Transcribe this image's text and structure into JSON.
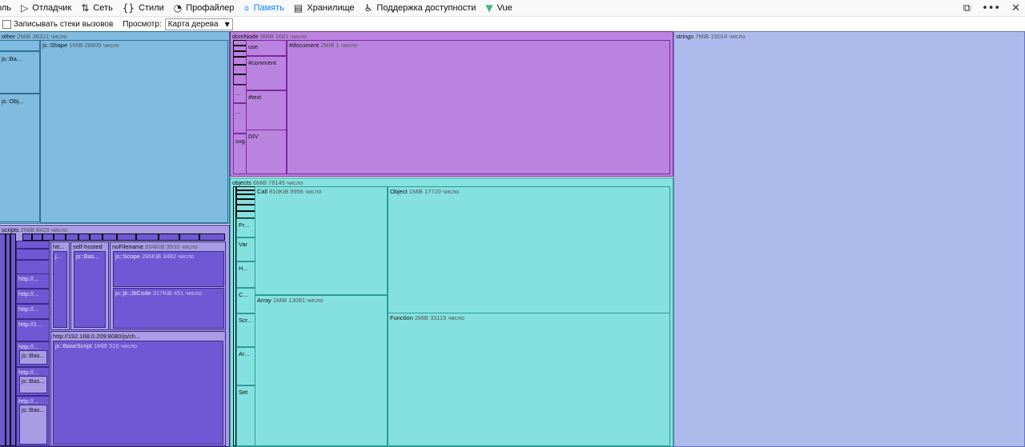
{
  "toolbar": {
    "tabs": [
      {
        "label": "оль",
        "icon": "console-icon"
      },
      {
        "label": "Отладчик",
        "icon": "debugger-icon"
      },
      {
        "label": "Сеть",
        "icon": "network-icon"
      },
      {
        "label": "Стили",
        "icon": "braces-icon"
      },
      {
        "label": "Профайлер",
        "icon": "gauge-icon"
      },
      {
        "label": "Память",
        "icon": "memory-icon",
        "active": true
      },
      {
        "label": "Хранилище",
        "icon": "storage-icon"
      },
      {
        "label": "Поддержка доступности",
        "icon": "accessibility-icon"
      },
      {
        "label": "Vue",
        "icon": "vue-icon"
      }
    ],
    "right_icons": [
      "dock-icon",
      "more-icon",
      "close-icon"
    ]
  },
  "subbar": {
    "record_label": "Записывать стеки вызовов",
    "view_label": "Просмотр:",
    "view_value": "Карта дерева"
  },
  "treemap": {
    "other": {
      "name": "other",
      "size": "2MiB",
      "count": "38321 число"
    },
    "other_children": {
      "ba": "js::Ba...",
      "obj": "js::Obj...",
      "shape": {
        "name": "js::Shape",
        "size": "1MiB",
        "count": "28905 число"
      }
    },
    "scripts": {
      "name": "scripts",
      "size": "2MiB",
      "count": "8426 число"
    },
    "scripts_children": {
      "http_short": "http://...",
      "http_1": "http://1...",
      "bas": "js::Bas...",
      "htt": "htt...",
      "j": "j...",
      "self_hosted": "self-hosted",
      "self_bas": "js::Bas...",
      "nofilename": {
        "name": "noFilename",
        "size": "604KiB",
        "count": "3933 число"
      },
      "scope": {
        "name": "js::Scope",
        "size": "286KiB",
        "count": "3482 число"
      },
      "jitcode": {
        "name": "js::jit::JitCode",
        "size": "317KiB",
        "count": "451 число"
      },
      "http_big": "http://192.168.0.209:8080/js/ch...",
      "basescript": {
        "name": "js::BaseScript",
        "size": "1MiB",
        "count": "510 число"
      }
    },
    "domnode": {
      "name": "domNode",
      "size": "3MiB",
      "count": "1661 число"
    },
    "domnode_children": {
      "use": "use",
      "comment": "#comment",
      "text": "#text",
      "div": "DIV",
      "svg": "svg",
      "ell1": "...",
      "ell2": "...",
      "document": {
        "name": "#document",
        "size": "2MiB",
        "count": "1 число"
      }
    },
    "objects": {
      "name": "objects",
      "size": "6MiB",
      "count": "78145 число"
    },
    "objects_children": {
      "pr": "Pr...",
      "var": "Var",
      "h": "H...",
      "c": "C...",
      "scr": "Scr...",
      "ar": "Ar...",
      "set": "Set",
      "call": {
        "name": "Call",
        "size": "810KiB",
        "count": "9956 число"
      },
      "array": {
        "name": "Array",
        "size": "1MiB",
        "count": "13081 число"
      },
      "object": {
        "name": "Object",
        "size": "1MiB",
        "count": "17720 число"
      },
      "function": {
        "name": "Function",
        "size": "2MiB",
        "count": "33115 число"
      }
    },
    "strings": {
      "name": "strings",
      "size": "7MiB",
      "count": "19014 число"
    },
    "colors": {
      "other": "#80bbdf",
      "domNode": "#ba83e0",
      "objects": "#84e1df",
      "strings": "#adbbec",
      "scripts": "#6f58d4"
    }
  }
}
